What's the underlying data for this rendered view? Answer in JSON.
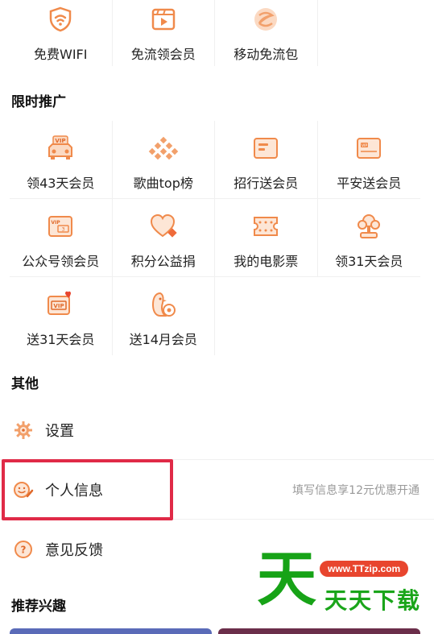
{
  "top_services": [
    {
      "label": "免费WIFI",
      "icon": "wifi-shield-icon"
    },
    {
      "label": "免流领会员",
      "icon": "video-play-icon"
    },
    {
      "label": "移动免流包",
      "icon": "china-mobile-icon"
    }
  ],
  "promo": {
    "title": "限时推广",
    "items": [
      {
        "label": "领43天会员",
        "icon": "vip-car-icon"
      },
      {
        "label": "歌曲top榜",
        "icon": "dots-chart-icon"
      },
      {
        "label": "招行送会员",
        "icon": "card-icon"
      },
      {
        "label": "平安送会员",
        "icon": "vip-card-icon"
      },
      {
        "label": "公众号领会员",
        "icon": "vip-ticket-icon"
      },
      {
        "label": "积分公益捐",
        "icon": "heart-icon"
      },
      {
        "label": "我的电影票",
        "icon": "film-ticket-icon"
      },
      {
        "label": "领31天会员",
        "icon": "gift-tree-icon"
      },
      {
        "label": "送31天会员",
        "icon": "vip-heart-icon"
      },
      {
        "label": "送14月会员",
        "icon": "penguin-icon"
      }
    ]
  },
  "other": {
    "title": "其他",
    "items": [
      {
        "label": "设置",
        "icon": "gear-icon",
        "hint": ""
      },
      {
        "label": "个人信息",
        "icon": "smile-edit-icon",
        "hint": "填写信息享12元优惠开通"
      },
      {
        "label": "意见反馈",
        "icon": "question-icon",
        "hint": ""
      }
    ]
  },
  "interest": {
    "title": "推荐兴趣"
  },
  "watermark": {
    "big": "天",
    "site": "www.TTzip.com",
    "name": "天天下载"
  },
  "colors": {
    "accent": "#f08a4b",
    "highlight": "#e02a47",
    "watermark_green": "#17a317"
  }
}
